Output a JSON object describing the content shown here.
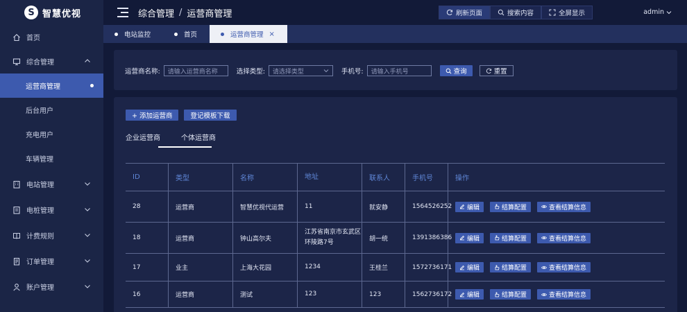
{
  "app": {
    "logo_mark": "S",
    "name": "智慧优视"
  },
  "sidebar": {
    "items": [
      {
        "label": "首页",
        "icon": "home-icon"
      },
      {
        "label": "综合管理",
        "icon": "monitor-icon",
        "expanded": true,
        "children": [
          {
            "label": "运营商管理",
            "active": true
          },
          {
            "label": "后台用户"
          },
          {
            "label": "充电用户"
          },
          {
            "label": "车辆管理"
          }
        ]
      },
      {
        "label": "电站管理",
        "icon": "building-icon"
      },
      {
        "label": "电桩管理",
        "icon": "charger-icon"
      },
      {
        "label": "计费规则",
        "icon": "book-icon"
      },
      {
        "label": "订单管理",
        "icon": "document-icon"
      },
      {
        "label": "账户管理",
        "icon": "user-icon"
      }
    ]
  },
  "header": {
    "breadcrumb": [
      "综合管理",
      "运营商管理"
    ],
    "breadcrumb_sep": "/",
    "tools": [
      "刷新页面",
      "搜索内容",
      "全屏显示"
    ],
    "user": "admin"
  },
  "tabs": [
    {
      "label": "电站监控"
    },
    {
      "label": "首页"
    },
    {
      "label": "运营商管理",
      "active": true,
      "close": "×"
    }
  ],
  "search": {
    "name_label": "运营商名称:",
    "name_placeholder": "请输入运营商名称",
    "type_label": "选择类型:",
    "type_placeholder": "请选择类型",
    "phone_label": "手机号:",
    "phone_placeholder": "请输入手机号",
    "query_label": "查询",
    "reset_label": "重置"
  },
  "actions": {
    "add_label": "+ 添加运营商",
    "download_label": "登记模板下载"
  },
  "content_tabs": [
    {
      "label": "企业运营商",
      "active": true
    },
    {
      "label": "个体运营商"
    }
  ],
  "table": {
    "columns": [
      "ID",
      "类型",
      "名称",
      "地址",
      "联系人",
      "手机号",
      "操作"
    ],
    "rows": [
      {
        "id": "28",
        "type": "运营商",
        "name": "智慧优视代运营",
        "address": "11",
        "contact": "就安静",
        "phone": "1564526252"
      },
      {
        "id": "18",
        "type": "运营商",
        "name": "钟山高尔夫",
        "address": "江苏省南京市玄武区环陵路7号",
        "contact": "胡一统",
        "phone": "1391386386"
      },
      {
        "id": "17",
        "type": "业主",
        "name": "上海大花园",
        "address": "1234",
        "contact": "王桂兰",
        "phone": "1572736171"
      },
      {
        "id": "16",
        "type": "运营商",
        "name": "测试",
        "address": "123",
        "contact": "123",
        "phone": "1562736172"
      }
    ],
    "ops": {
      "edit": "编辑",
      "settle_config": "结算配置",
      "view_settle": "查看结算信息"
    }
  },
  "colors": {
    "sidebar_bg": "#1b2546",
    "page_bg": "#121a38",
    "accent": "#3d5aae",
    "header_text": "#5f86d6"
  }
}
